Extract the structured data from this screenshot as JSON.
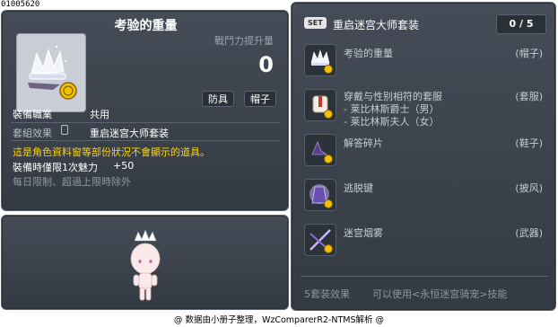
{
  "item_id": "01005620",
  "item": {
    "title": "考验的重量",
    "stat_label": "戰鬥力提升量",
    "stat_value": "0",
    "tags": [
      "防具",
      "帽子"
    ],
    "job_label": "裝備職業",
    "job_value": "共用",
    "set_label": "套組效果",
    "set_value": "重启迷宫大师套装",
    "warning": "這是角色資料窗等部份狀況不會顯示的道具。",
    "time_limit": "裝備時僅限1次魅力",
    "charm_bonus": "+50",
    "daily_limit": "每日限制、超過上限時除外"
  },
  "set_panel": {
    "badge": "SET",
    "name": "重启迷宫大师套装",
    "count": "0 / 5",
    "items": [
      {
        "name": "考验的重量",
        "category": "(帽子)",
        "icon": "crown-icon"
      },
      {
        "name": "穿戴与性别相符的套服",
        "sub": [
          "- 莱比林斯爵士（男）",
          "- 莱比林斯夫人（女）"
        ],
        "category": "(套服)",
        "icon": "suit-icon"
      },
      {
        "name": "解答碎片",
        "category": "(鞋子)",
        "icon": "shoes-icon"
      },
      {
        "name": "逃脱键",
        "category": "(披风)",
        "icon": "cape-icon"
      },
      {
        "name": "迷宫烟雾",
        "category": "(武器)",
        "icon": "weapon-icon"
      }
    ],
    "effect_label": "5套装效果",
    "effect_value": "可以使用<永恒迷宫骑宠>技能"
  },
  "credit": "@ 数据由小册子整理，WzComparerR2-NTMS解析 @",
  "colors": {
    "warning": "#ffd400",
    "panel_bg": "#3c434d",
    "coin": "#f2c200"
  }
}
